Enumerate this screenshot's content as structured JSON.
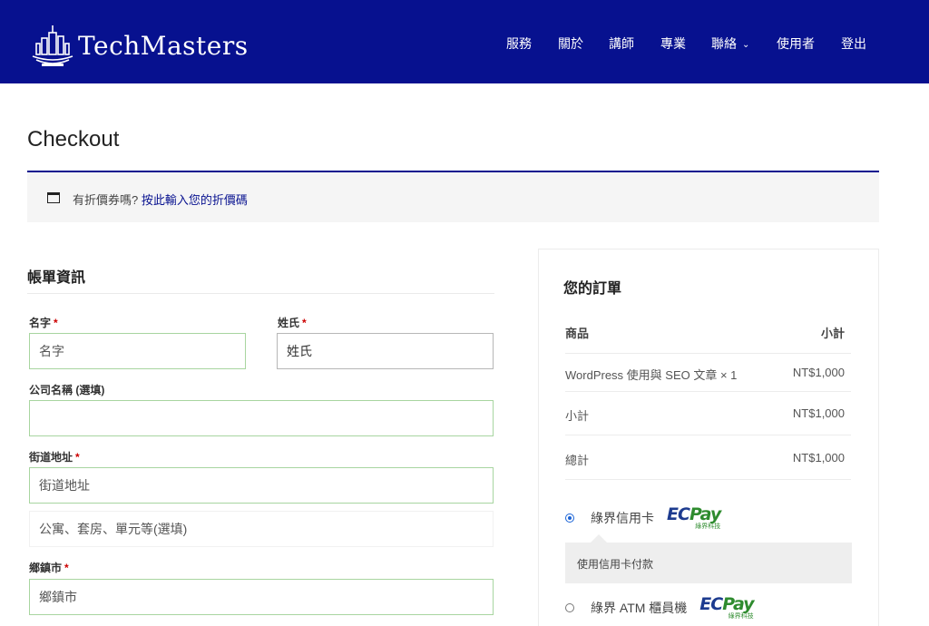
{
  "header": {
    "brand": "TechMasters",
    "nav": [
      {
        "label": "服務"
      },
      {
        "label": "關於"
      },
      {
        "label": "講師"
      },
      {
        "label": "專業"
      },
      {
        "label": "聯絡"
      },
      {
        "label": "使用者"
      },
      {
        "label": "登出"
      }
    ],
    "colors": {
      "header_bg": "#07118f",
      "accent": "#07118f"
    }
  },
  "page": {
    "title": "Checkout"
  },
  "coupon": {
    "text": "有折價券嗎?",
    "link": "按此輸入您的折價碼"
  },
  "billing": {
    "title": "帳單資訊",
    "first_name": {
      "label": "名字",
      "placeholder": "名字",
      "value": ""
    },
    "last_name": {
      "label": "姓氏",
      "value": "姓氏"
    },
    "company": {
      "label": "公司名稱 (選填)",
      "value": ""
    },
    "street": {
      "label": "街道地址",
      "placeholder": "街道地址"
    },
    "address2": {
      "placeholder": "公寓、套房、單元等(選填)"
    },
    "city": {
      "label": "鄉鎮市",
      "placeholder": "鄉鎮市"
    },
    "required_mark": "*"
  },
  "order": {
    "title": "您的訂單",
    "header_product": "商品",
    "header_subtotal": "小計",
    "items": [
      {
        "name": "WordPress 使用與 SEO 文章 × 1",
        "price": "NT$1,000"
      }
    ],
    "subtotal_label": "小計",
    "subtotal_value": "NT$1,000",
    "total_label": "總計",
    "total_value": "NT$1,000"
  },
  "payment": {
    "options": [
      {
        "label": "綠界信用卡",
        "selected": true,
        "logo": {
          "ec": "EC",
          "pay": "Pay",
          "sub": "綠界科技"
        }
      },
      {
        "label": "綠界 ATM 櫃員機",
        "selected": false,
        "logo": {
          "ec": "EC",
          "pay": "Pay",
          "sub": "綠界科技"
        }
      }
    ],
    "description": "使用信用卡付款"
  }
}
